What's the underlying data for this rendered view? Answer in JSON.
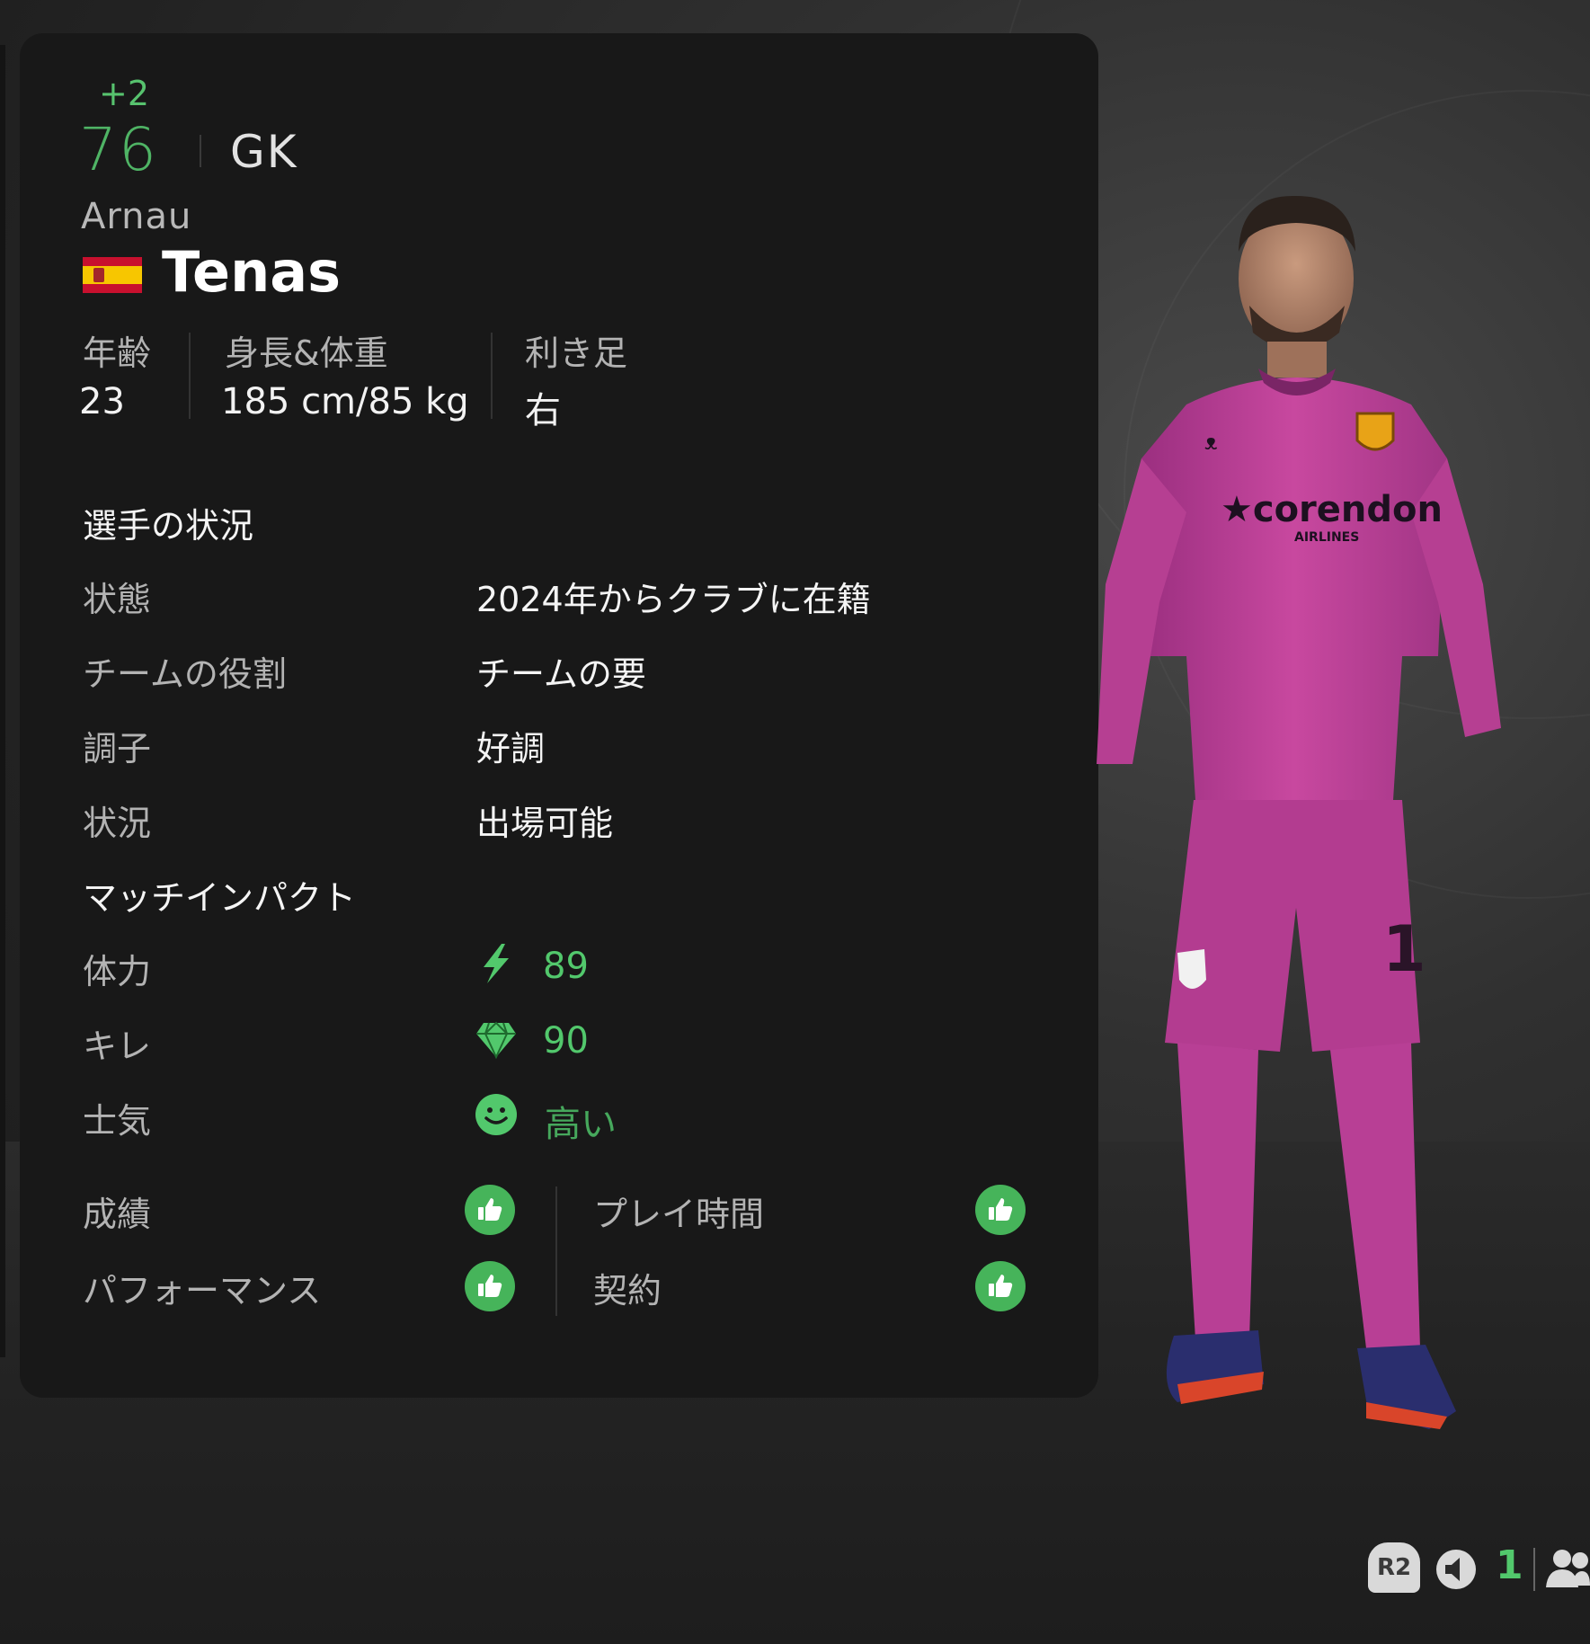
{
  "player": {
    "rating_delta": "+2",
    "rating": "76",
    "position": "GK",
    "first_name": "Arnau",
    "last_name": "Tenas",
    "nationality_flag": "spain-flag"
  },
  "bio": {
    "age_label": "年齢",
    "age_value": "23",
    "height_weight_label": "身長&体重",
    "height_weight_value": "185 cm/85 kg",
    "foot_label": "利き足",
    "foot_value": "右"
  },
  "status_section": {
    "title": "選手の状況",
    "rows": [
      {
        "label": "状態",
        "value": "2024年からクラブに在籍"
      },
      {
        "label": "チームの役割",
        "value": "チームの要"
      },
      {
        "label": "調子",
        "value": "好調"
      },
      {
        "label": "状況",
        "value": "出場可能"
      }
    ]
  },
  "impact_section": {
    "title": "マッチインパクト",
    "rows": [
      {
        "label": "体力",
        "value": "89",
        "icon": "lightning-icon"
      },
      {
        "label": "キレ",
        "value": "90",
        "icon": "diamond-icon"
      },
      {
        "label": "士気",
        "value": "高い",
        "icon": "smiley-icon"
      }
    ]
  },
  "feedback": {
    "left": [
      {
        "label": "成績",
        "icon": "thumbs-up-icon"
      },
      {
        "label": "パフォーマンス",
        "icon": "thumbs-up-icon"
      }
    ],
    "right": [
      {
        "label": "プレイ時間",
        "icon": "thumbs-up-icon"
      },
      {
        "label": "契約",
        "icon": "thumbs-up-icon"
      }
    ]
  },
  "hud": {
    "button": "R2",
    "count": "1"
  },
  "colors": {
    "accent_green": "#52c86c",
    "panel_bg": "#181818",
    "kit_pink": "#c0419f"
  }
}
